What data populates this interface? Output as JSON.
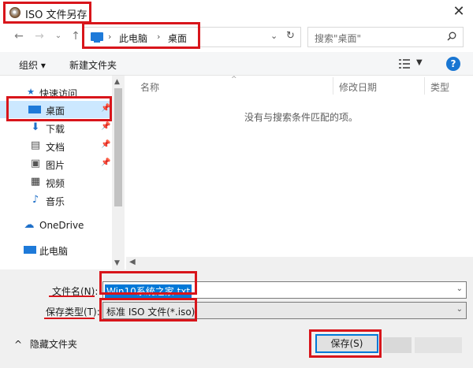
{
  "window": {
    "title": "ISO 文件另存",
    "close_glyph": "✕"
  },
  "address": {
    "segments": [
      "此电脑",
      "桌面"
    ],
    "separator": "›"
  },
  "search": {
    "placeholder": "搜索\"桌面\""
  },
  "toolbar": {
    "organize_label": "组织 ▾",
    "new_folder_label": "新建文件夹"
  },
  "sidebar": {
    "items": [
      {
        "label": "快速访问",
        "icon": "star-icon",
        "glyph": "★",
        "color": "#1e6fc8"
      },
      {
        "label": "桌面",
        "icon": "desktop-icon",
        "glyph": "",
        "color": "#1e7ad9",
        "pinned": true,
        "selected": true
      },
      {
        "label": "下载",
        "icon": "download-icon",
        "glyph": "⬇",
        "color": "#1e6fc8",
        "pinned": true
      },
      {
        "label": "文档",
        "icon": "document-icon",
        "glyph": "▤",
        "color": "#555555",
        "pinned": true
      },
      {
        "label": "图片",
        "icon": "pictures-icon",
        "glyph": "▣",
        "color": "#555555",
        "pinned": true
      },
      {
        "label": "视频",
        "icon": "video-icon",
        "glyph": "▦",
        "color": "#333333"
      },
      {
        "label": "音乐",
        "icon": "music-icon",
        "glyph": "♪",
        "color": "#1e6fc8"
      },
      {
        "label": "OneDrive",
        "icon": "cloud-icon",
        "glyph": "☁",
        "color": "#1e6fc8"
      },
      {
        "label": "此电脑",
        "icon": "computer-icon",
        "glyph": "",
        "color": "#1e7ad9"
      }
    ]
  },
  "list": {
    "columns": [
      "名称",
      "修改日期",
      "类型"
    ],
    "empty_message": "没有与搜索条件匹配的项。"
  },
  "form": {
    "filename_label": "文件名(N):",
    "filename_value": "Win10系统之家.txt",
    "filetype_label": "保存类型(T):",
    "filetype_value": "标准 ISO 文件(*.iso)"
  },
  "footer": {
    "hide_folders_label": "隐藏文件夹",
    "save_label": "保存(S)"
  },
  "colors": {
    "highlight_red": "#d8151b",
    "selection_blue": "#0078d7",
    "nav_selected": "#cce8ff"
  }
}
